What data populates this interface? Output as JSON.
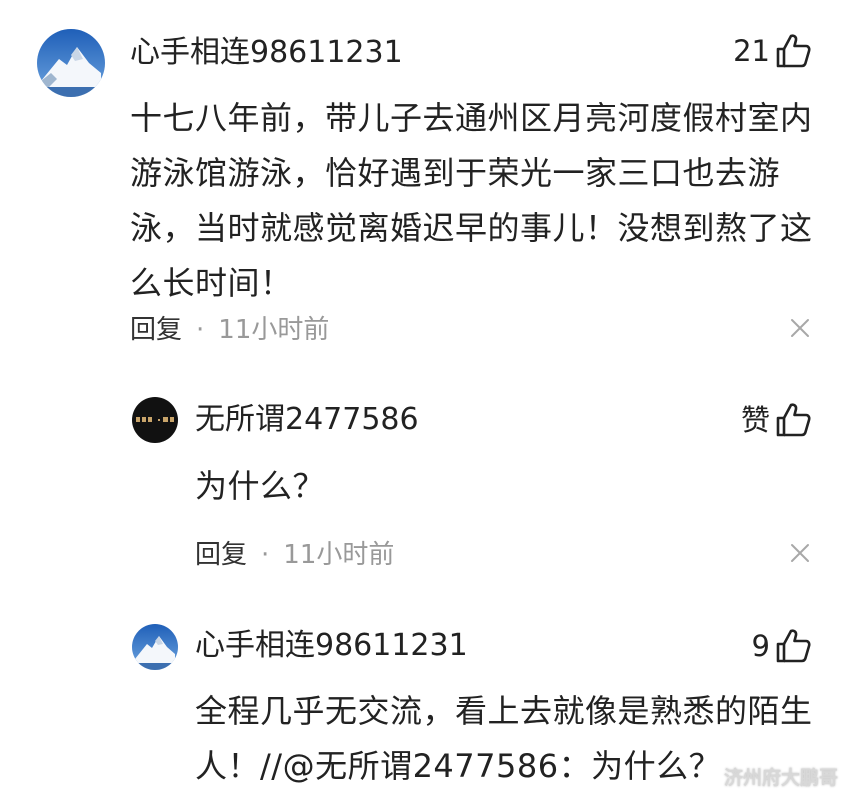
{
  "comments": [
    {
      "username": "心手相连98611231",
      "likes": "21",
      "text": "十七八年前，带儿子去通州区月亮河度假村室内游泳馆游泳，恰好遇到于荣光一家三口也去游泳，当时就感觉离婚迟早的事儿！没想到熬了这么长时间！",
      "reply_label": "回复",
      "separator": "·",
      "time": "11小时前"
    },
    {
      "username": "无所谓2477586",
      "likes": "赞",
      "text": "为什么？",
      "reply_label": "回复",
      "separator": "·",
      "time": "11小时前"
    },
    {
      "username": "心手相连98611231",
      "likes": "9",
      "text": "全程几乎无交流，看上去就像是熟悉的陌生人！//@无所谓2477586：为什么？"
    }
  ],
  "watermark": "济州府大鹏哥",
  "icons": {
    "like": "thumbs-up-icon",
    "close": "close-icon",
    "avatar_mountain": "mountain-avatar",
    "avatar_dark": "dark-avatar"
  },
  "colors": {
    "text": "#222222",
    "meta": "#999999",
    "avatar_sky": "#2f6fc4"
  }
}
